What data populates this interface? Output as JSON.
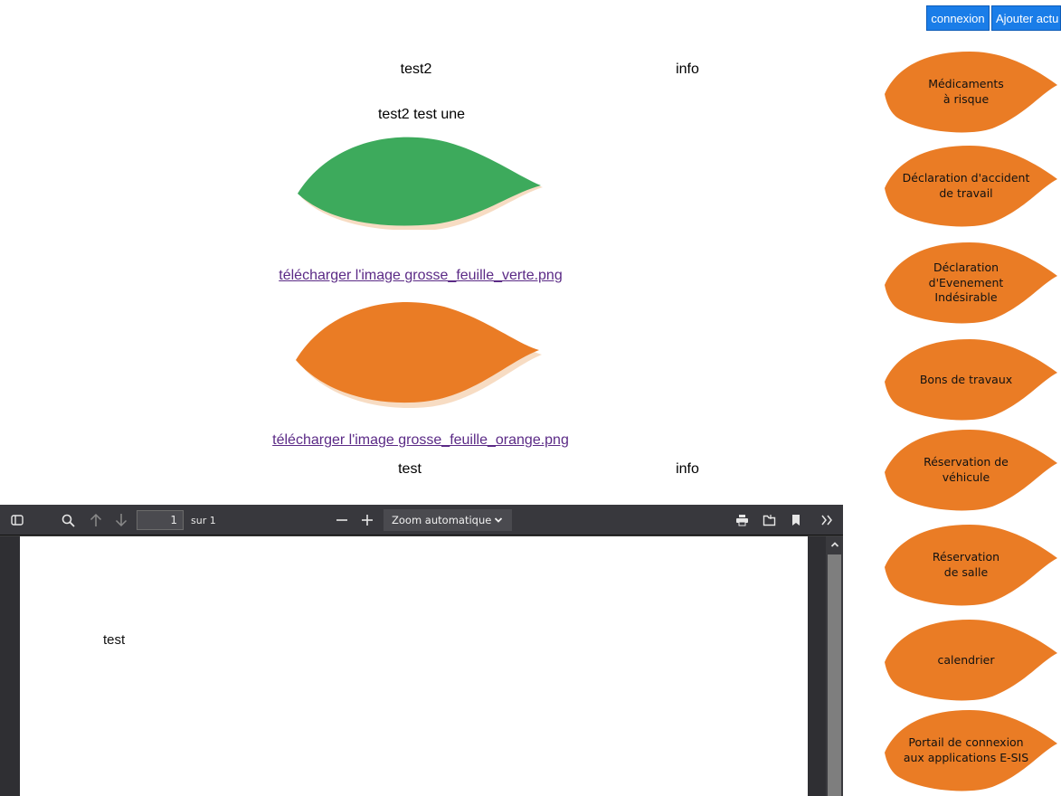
{
  "header": {
    "connexion_label": "connexion",
    "ajouter_label": "Ajouter actu",
    "accent_color": "#1a7de8"
  },
  "articles": [
    {
      "title": "test2",
      "category": "info",
      "body": "test2 test une",
      "images": [
        {
          "leaf_color": "#3daa5c",
          "link_text": "télécharger l'image grosse_feuille_verte.png"
        },
        {
          "leaf_color": "#ea7c25",
          "link_text": "télécharger l'image grosse_feuille_orange.png"
        }
      ]
    },
    {
      "title": "test",
      "category": "info"
    }
  ],
  "sidebar": {
    "leaf_color": "#ea7c25",
    "items": [
      {
        "label": "Médicaments\nà risque"
      },
      {
        "label": "Déclaration d'accident\nde travail"
      },
      {
        "label": "Déclaration\nd'Evenement\nIndésirable"
      },
      {
        "label": "Bons de travaux"
      },
      {
        "label": "Réservation de\nvéhicule"
      },
      {
        "label": "Réservation\nde salle"
      },
      {
        "label": "calendrier"
      },
      {
        "label": "Portail de connexion\naux applications E-SIS"
      }
    ]
  },
  "pdf_viewer": {
    "page_number": "1",
    "page_count_label": "sur 1",
    "zoom_label": "Zoom automatique",
    "document_text": "test",
    "icons": [
      "sidebar-toggle-icon",
      "search-icon",
      "arrow-up-icon",
      "arrow-down-icon",
      "zoom-out-icon",
      "zoom-in-icon",
      "print-icon",
      "open-file-icon",
      "bookmark-icon",
      "more-tools-icon"
    ]
  }
}
